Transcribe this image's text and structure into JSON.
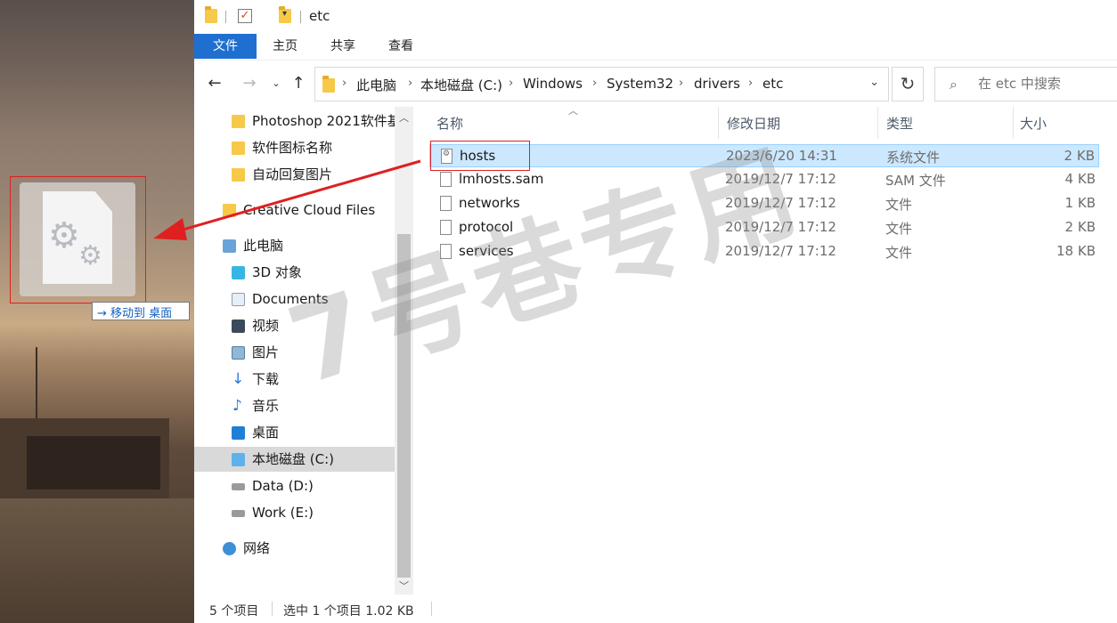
{
  "titlebar": {
    "title": "etc"
  },
  "ribbon": {
    "tabs": [
      "文件",
      "主页",
      "共享",
      "查看"
    ]
  },
  "address": {
    "crumbs": [
      "此电脑",
      "本地磁盘 (C:)",
      "Windows",
      "System32",
      "drivers",
      "etc"
    ]
  },
  "search": {
    "placeholder": "在 etc 中搜索"
  },
  "navpane": {
    "items": [
      {
        "label": "Photoshop 2021软件基",
        "icon": "folder-icon"
      },
      {
        "label": "软件图标名称",
        "icon": "folder-icon"
      },
      {
        "label": "自动回复图片",
        "icon": "folder-icon"
      },
      {
        "label": "Creative Cloud Files",
        "icon": "cloud-folder-icon"
      },
      {
        "label": "此电脑",
        "icon": "computer-icon"
      },
      {
        "label": "3D 对象",
        "icon": "3d-objects-icon"
      },
      {
        "label": "Documents",
        "icon": "documents-icon"
      },
      {
        "label": "视频",
        "icon": "video-icon"
      },
      {
        "label": "图片",
        "icon": "pictures-icon"
      },
      {
        "label": "下载",
        "icon": "download-icon"
      },
      {
        "label": "音乐",
        "icon": "music-icon"
      },
      {
        "label": "桌面",
        "icon": "desktop-icon"
      },
      {
        "label": "本地磁盘 (C:)",
        "icon": "windows-drive-icon"
      },
      {
        "label": "Data (D:)",
        "icon": "drive-icon"
      },
      {
        "label": "Work (E:)",
        "icon": "drive-icon"
      },
      {
        "label": "网络",
        "icon": "network-icon"
      }
    ]
  },
  "filelist": {
    "columns": {
      "name": "名称",
      "date": "修改日期",
      "type": "类型",
      "size": "大小"
    },
    "rows": [
      {
        "name": "hosts",
        "date": "2023/6/20 14:31",
        "type": "系统文件",
        "size": "2 KB"
      },
      {
        "name": "lmhosts.sam",
        "date": "2019/12/7 17:12",
        "type": "SAM 文件",
        "size": "4 KB"
      },
      {
        "name": "networks",
        "date": "2019/12/7 17:12",
        "type": "文件",
        "size": "1 KB"
      },
      {
        "name": "protocol",
        "date": "2019/12/7 17:12",
        "type": "文件",
        "size": "2 KB"
      },
      {
        "name": "services",
        "date": "2019/12/7 17:12",
        "type": "文件",
        "size": "18 KB"
      }
    ]
  },
  "status": {
    "count": "5 个项目",
    "selection": "选中 1 个项目  1.02 KB"
  },
  "desktop": {
    "move_tip": "→ 移动到 桌面"
  },
  "watermark": "7号巷专用",
  "colors": {
    "accent": "#1f6fd1",
    "selection": "#cce8ff",
    "annotation": "#e02020"
  }
}
